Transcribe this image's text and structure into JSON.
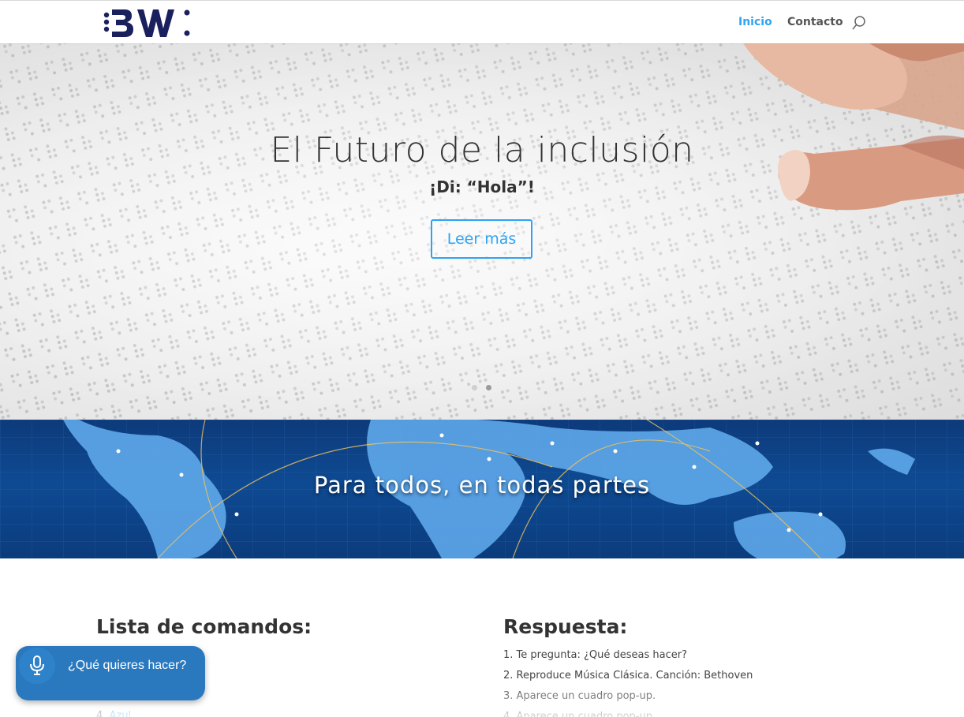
{
  "header": {
    "logo_alt": "BW",
    "nav": [
      {
        "label": "Inicio",
        "active": true
      },
      {
        "label": "Contacto",
        "active": false
      }
    ],
    "search_icon": "search-icon"
  },
  "hero": {
    "title": "El Futuro de la inclusión",
    "subtitle": "¡Di: “Hola”!",
    "button_label": "Leer más",
    "slides_count": 2,
    "active_slide": 2
  },
  "banner": {
    "title": "Para todos, en todas partes"
  },
  "commands": {
    "title": "Lista de comandos:",
    "partial_item_number": "4.",
    "partial_item_label": "Azul"
  },
  "responses": {
    "title": "Respuesta:",
    "items": [
      "1. Te pregunta: ¿Qué deseas hacer?",
      "2. Reproduce Música Clásica. Canción: Bethoven",
      "3. Aparece un cuadro pop-up.",
      "4. Aparece un cuadro pop-up."
    ]
  },
  "voice_widget": {
    "prompt": "¿Qué quieres hacer?",
    "icon": "microphone-icon"
  },
  "colors": {
    "accent": "#2ea3f2",
    "logo": "#1a1f5e",
    "voice_widget": "#2a79bf"
  }
}
